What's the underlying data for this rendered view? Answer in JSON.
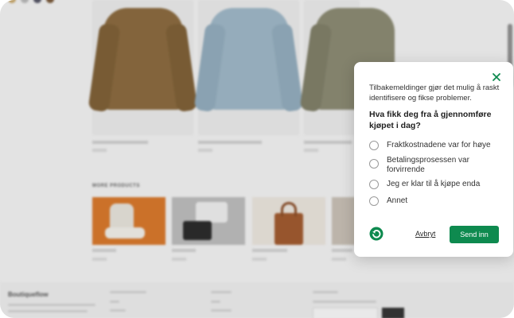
{
  "colors": {
    "accent": "#0e8a4f",
    "backdrop": "#f3f3f3",
    "sweater_brown": "#8b6a3e",
    "sweater_blue": "#9fb8c8",
    "sweater_olive": "#8b8a72"
  },
  "dialog": {
    "intro": "Tilbakemeldinger gjør det mulig å raskt identifisere og fikse problemer.",
    "question": "Hva fikk deg fra å gjennomføre kjøpet i dag?",
    "options": [
      "Fraktkostnadene var for høye",
      "Betalingsprosessen var forvirrende",
      "Jeg er klar til å kjøpe enda",
      "Annet"
    ],
    "cancel_label": "Avbryt",
    "submit_label": "Send inn",
    "close_icon": "close-icon",
    "logo_icon": "refresh-logo-icon"
  },
  "store": {
    "section_title": "MORE PRODUCTS",
    "brand": "Boutiqueflow"
  }
}
